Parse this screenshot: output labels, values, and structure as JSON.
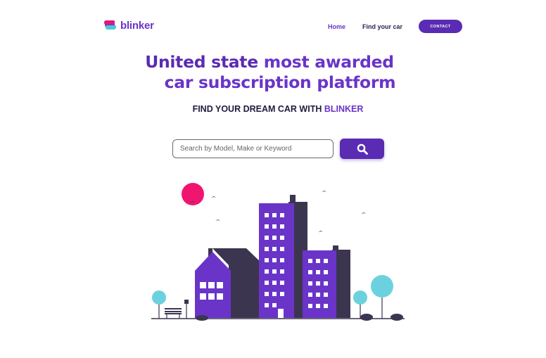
{
  "header": {
    "logo_text": "blinker",
    "nav": {
      "home": "Home",
      "find_car": "Find your car",
      "contact": "CONTACT"
    }
  },
  "hero": {
    "title_part1": "United state",
    "title_part2": " most awarded",
    "title_line2": "car subscription platform",
    "subtitle_prefix": "FIND YOUR DREAM CAR WITH ",
    "subtitle_brand": "BLINKER"
  },
  "search": {
    "placeholder": "Search by Model, Make or Keyword",
    "button_icon": "search-icon"
  },
  "colors": {
    "brand_purple": "#6a34c9",
    "button_purple": "#5a2bb3",
    "sun_pink": "#f0166f",
    "tree_cyan": "#6cd1df",
    "building_dark": "#3c3550",
    "building_purple": "#6a34c9"
  }
}
